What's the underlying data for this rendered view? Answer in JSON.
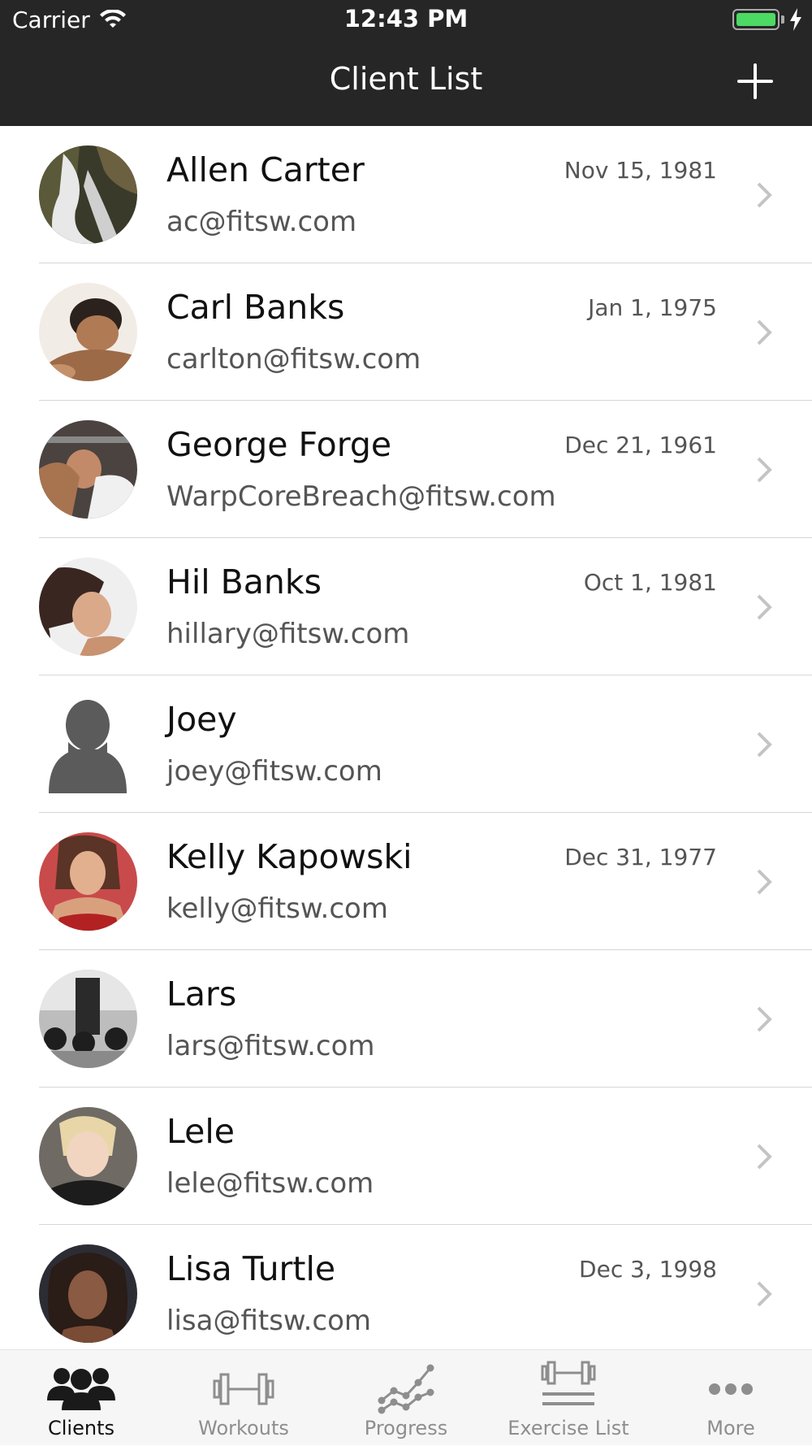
{
  "status_bar": {
    "carrier": "Carrier",
    "time": "12:43 PM",
    "battery_level": 1.0,
    "charging": true
  },
  "nav": {
    "title": "Client List",
    "add_icon": "plus-icon"
  },
  "clients": [
    {
      "name": "Allen Carter",
      "email": "ac@fitsw.com",
      "dob": "Nov 15, 1981",
      "avatar": "waterfall-photo"
    },
    {
      "name": "Carl Banks",
      "email": "carlton@fitsw.com",
      "dob": "Jan 1, 1975",
      "avatar": "man-photo"
    },
    {
      "name": "George Forge",
      "email": "WarpCoreBreach@fitsw.com",
      "dob": "Dec 21, 1961",
      "avatar": "lifter-photo"
    },
    {
      "name": "Hil Banks",
      "email": "hillary@fitsw.com",
      "dob": "Oct 1, 1981",
      "avatar": "woman-photo"
    },
    {
      "name": "Joey",
      "email": "joey@fitsw.com",
      "dob": "",
      "avatar": "placeholder-person-icon"
    },
    {
      "name": "Kelly Kapowski",
      "email": "kelly@fitsw.com",
      "dob": "Dec 31, 1977",
      "avatar": "woman-red-photo"
    },
    {
      "name": "Lars",
      "email": "lars@fitsw.com",
      "dob": "",
      "avatar": "gym-photo"
    },
    {
      "name": "Lele",
      "email": "lele@fitsw.com",
      "dob": "",
      "avatar": "child-photo"
    },
    {
      "name": "Lisa Turtle",
      "email": "lisa@fitsw.com",
      "dob": "Dec 3, 1998",
      "avatar": "woman-portrait-photo"
    }
  ],
  "tabs": [
    {
      "label": "Clients",
      "icon": "people-icon",
      "active": true
    },
    {
      "label": "Workouts",
      "icon": "dumbbell-icon",
      "active": false
    },
    {
      "label": "Progress",
      "icon": "progress-chart-icon",
      "active": false
    },
    {
      "label": "Exercise List",
      "icon": "exercise-list-icon",
      "active": false
    },
    {
      "label": "More",
      "icon": "more-dots-icon",
      "active": false
    }
  ],
  "colors": {
    "header_bg": "#262626",
    "tab_active": "#111111",
    "tab_inactive": "#8e8e8e",
    "battery": "#4cd964"
  }
}
